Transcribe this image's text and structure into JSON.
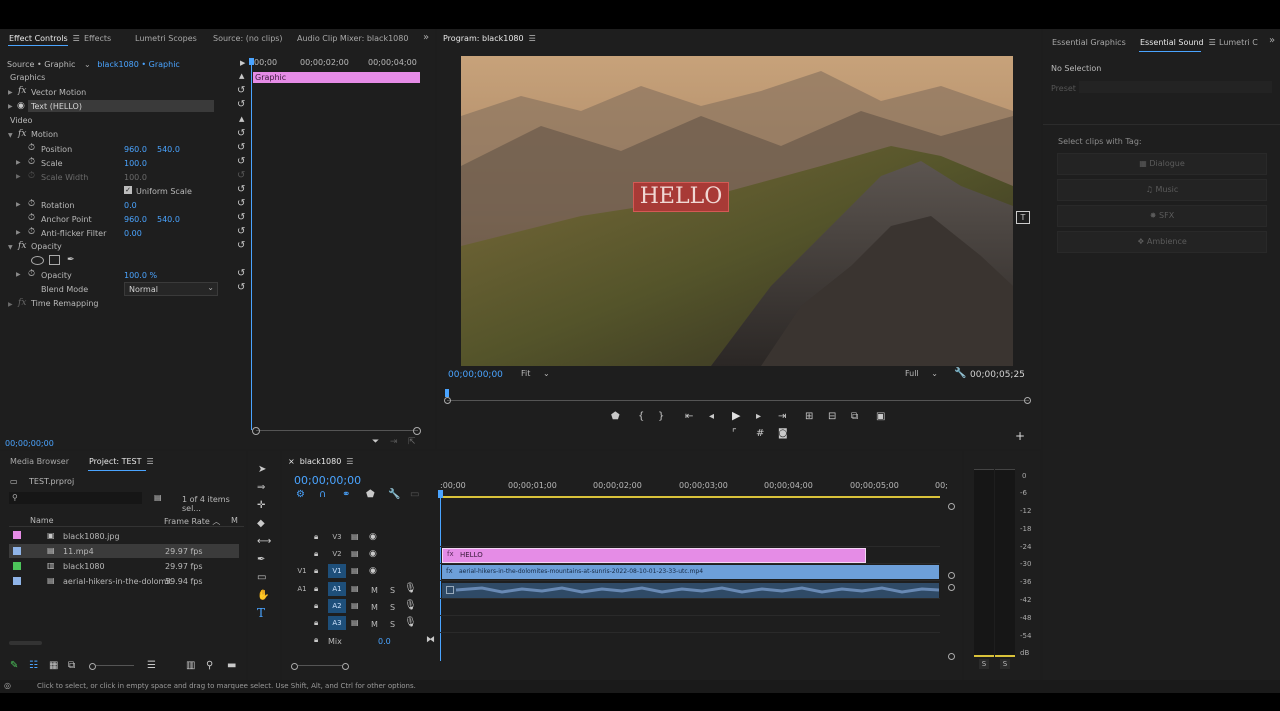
{
  "effect_controls": {
    "tabs": [
      {
        "label": "Effect Controls",
        "active": true
      },
      {
        "label": "Effects"
      },
      {
        "label": "Lumetri Scopes"
      },
      {
        "label": "Source: (no clips)"
      },
      {
        "label": "Audio Clip Mixer: black1080"
      }
    ],
    "overflow": "»",
    "source_label": "Source • Graphic",
    "clip_link": "black1080 • Graphic",
    "ruler": [
      "00;00",
      "00;00;02;00",
      "00;00;04;00"
    ],
    "graphic_clip_label": "Graphic",
    "timecode": "00;00;00;00",
    "sections": {
      "graphics": "Graphics",
      "video": "Video",
      "vector_motion": "Vector Motion",
      "text_layer": "Text (HELLO)",
      "motion": "Motion",
      "opacity_group": "Opacity",
      "time_remapping": "Time Remapping"
    },
    "fx": "fx",
    "props": {
      "position": {
        "label": "Position",
        "x": "960.0",
        "y": "540.0"
      },
      "scale": {
        "label": "Scale",
        "value": "100.0"
      },
      "scale_width": {
        "label": "Scale Width",
        "value": "100.0"
      },
      "uniform_scale": "Uniform Scale",
      "rotation": {
        "label": "Rotation",
        "value": "0.0"
      },
      "anchor": {
        "label": "Anchor Point",
        "x": "960.0",
        "y": "540.0"
      },
      "antiflicker": {
        "label": "Anti-flicker Filter",
        "value": "0.00"
      },
      "opacity": {
        "label": "Opacity",
        "value": "100.0 %"
      },
      "blend": {
        "label": "Blend Mode",
        "value": "Normal"
      }
    }
  },
  "program": {
    "title": "Program: black1080",
    "overlay_text": "HELLO",
    "timecode_left": "00;00;00;00",
    "fit": "Fit",
    "quality": "Full",
    "timecode_right": "00;00;05;25"
  },
  "essential": {
    "tabs": [
      {
        "label": "Essential Graphics"
      },
      {
        "label": "Essential Sound",
        "active": true
      },
      {
        "label": "Lumetri C"
      }
    ],
    "overflow": "»",
    "no_selection": "No Selection",
    "preset": "Preset",
    "select_tag": "Select clips with Tag:",
    "tags": [
      "Dialogue",
      "Music",
      "SFX",
      "Ambience"
    ]
  },
  "project": {
    "tabs": [
      {
        "label": "Media Browser"
      },
      {
        "label": "Project: TEST",
        "active": true
      }
    ],
    "file": "TEST.prproj",
    "items_count": "1 of 4 items sel...",
    "col_name": "Name",
    "col_rate": "Frame Rate",
    "col_m": "M",
    "items": [
      {
        "name": "black1080.jpg",
        "rate": "",
        "color": "#e58ce6"
      },
      {
        "name": "11.mp4",
        "rate": "29.97 fps",
        "color": "#8fb4e8"
      },
      {
        "name": "black1080",
        "rate": "29.97 fps",
        "color": "#4cc45a"
      },
      {
        "name": "aerial-hikers-in-the-dolomit",
        "rate": "59.94 fps",
        "color": "#8fb4e8"
      }
    ]
  },
  "timeline": {
    "sequence": "black1080",
    "timecode": "00;00;00;00",
    "ruler": [
      ":00;00",
      "00;00;01;00",
      "00;00;02;00",
      "00;00;03;00",
      "00;00;04;00",
      "00;00;05;00",
      "00;"
    ],
    "tracks": {
      "v3": "V3",
      "v2": "V2",
      "v1": "V1",
      "a1": "A1",
      "a2": "A2",
      "a3": "A3",
      "mix": "Mix",
      "mix_value": "0.0"
    },
    "clip_hello": "HELLO",
    "clip_video": "aerial-hikers-in-the-dolomites-mountains-at-sunris-2022-08-10-01-23-33-utc.mp4",
    "track_m": "M",
    "track_s": "S"
  },
  "meter": {
    "scale": [
      "0",
      "-6",
      "-12",
      "-18",
      "-24",
      "-30",
      "-36",
      "-42",
      "-48",
      "-54",
      "dB"
    ],
    "solo_left": "S",
    "solo_right": "S"
  },
  "status": "Click to select, or click in empty space and drag to marquee select. Use Shift, Alt, and Ctrl for other options.",
  "colors": {
    "accent": "#4aa4ff",
    "graphic_clip": "#e58ce6",
    "video_clip": "#6d9fd9",
    "audio_track": "#1e4f7a"
  }
}
